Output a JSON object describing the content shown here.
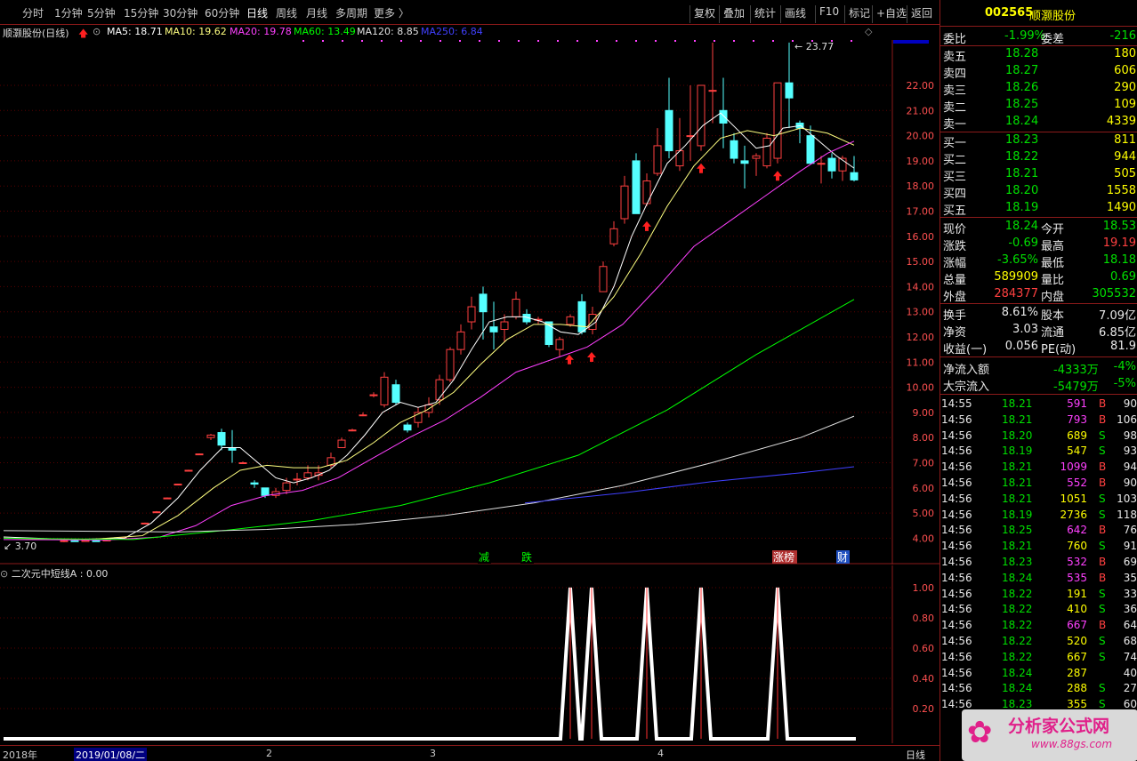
{
  "toolbar": {
    "periods": [
      "分时",
      "1分钟",
      "5分钟",
      "15分钟",
      "30分钟",
      "60分钟",
      "日线",
      "周线",
      "月线",
      "多周期",
      "更多 〉"
    ],
    "active_period": "日线",
    "tools": [
      "复权",
      "叠加",
      "统计",
      "画线",
      "F10",
      "标记",
      "+自选",
      "返回"
    ]
  },
  "stock": {
    "code": "002565",
    "name": "顺灏股份"
  },
  "main_chart": {
    "title": "顺灏股份(日线)",
    "ma_labels": [
      {
        "text": "MA5: 18.71",
        "color": "#ffffff"
      },
      {
        "text": "MA10: 19.62",
        "color": "#ffff80"
      },
      {
        "text": "MA20: 19.78",
        "color": "#ff40ff"
      },
      {
        "text": "MA60: 13.49",
        "color": "#00ff00"
      },
      {
        "text": "MA120: 8.85",
        "color": "#e0e0e0"
      },
      {
        "text": "MA250: 6.84",
        "color": "#4040ff"
      }
    ],
    "high_marker": "23.77",
    "low_marker": "3.70",
    "top_price": "23.66",
    "price_ticks": [
      "22.00",
      "21.00",
      "20.00",
      "19.00",
      "18.00",
      "17.00",
      "16.00",
      "15.00",
      "14.00",
      "13.00",
      "12.00",
      "11.00",
      "10.00",
      "9.00",
      "8.00",
      "7.00",
      "6.00",
      "5.00",
      "4.00"
    ],
    "event_marks": [
      {
        "text": "减",
        "color": "#00ff00",
        "bg": "#000"
      },
      {
        "text": "跌",
        "color": "#00ff00",
        "bg": "#000"
      },
      {
        "text": "涨榜",
        "color": "#ffffff",
        "bg": "#b03030"
      },
      {
        "text": "财",
        "color": "#ffffff",
        "bg": "#2050c0"
      }
    ]
  },
  "indicator": {
    "label": "二次元中短线A : 0.00",
    "ticks": [
      "1.00",
      "0.80",
      "0.60",
      "0.40",
      "0.20"
    ]
  },
  "dates": {
    "year": "2018年",
    "selected": "2019/01/08/二",
    "m2": "2",
    "m3": "3",
    "m4": "4",
    "mode": "日线"
  },
  "quote": {
    "weibi_label": "委比",
    "weibi": "-1.99%",
    "weicha_label": "委差",
    "weicha": "-216",
    "asks": [
      {
        "label": "卖五",
        "price": "18.28",
        "vol": "180"
      },
      {
        "label": "卖四",
        "price": "18.27",
        "vol": "606"
      },
      {
        "label": "卖三",
        "price": "18.26",
        "vol": "290"
      },
      {
        "label": "卖二",
        "price": "18.25",
        "vol": "109"
      },
      {
        "label": "卖一",
        "price": "18.24",
        "vol": "4339"
      }
    ],
    "bids": [
      {
        "label": "买一",
        "price": "18.23",
        "vol": "811"
      },
      {
        "label": "买二",
        "price": "18.22",
        "vol": "944"
      },
      {
        "label": "买三",
        "price": "18.21",
        "vol": "505"
      },
      {
        "label": "买四",
        "price": "18.20",
        "vol": "1558"
      },
      {
        "label": "买五",
        "price": "18.19",
        "vol": "1490"
      }
    ],
    "stats": [
      {
        "l1": "现价",
        "v1": "18.24",
        "c1": "#00e000",
        "l2": "今开",
        "v2": "18.53",
        "c2": "#00e000"
      },
      {
        "l1": "涨跌",
        "v1": "-0.69",
        "c1": "#00e000",
        "l2": "最高",
        "v2": "19.19",
        "c2": "#ff4040"
      },
      {
        "l1": "涨幅",
        "v1": "-3.65%",
        "c1": "#00e000",
        "l2": "最低",
        "v2": "18.18",
        "c2": "#00e000"
      },
      {
        "l1": "总量",
        "v1": "589909",
        "c1": "#ffff00",
        "l2": "量比",
        "v2": "0.69",
        "c2": "#00e000"
      },
      {
        "l1": "外盘",
        "v1": "284377",
        "c1": "#ff4040",
        "l2": "内盘",
        "v2": "305532",
        "c2": "#00e000"
      }
    ],
    "stats2": [
      {
        "l1": "换手",
        "v1": "8.61%",
        "c1": "#e8e8e8",
        "l2": "股本",
        "v2": "7.09亿",
        "c2": "#e8e8e8"
      },
      {
        "l1": "净资",
        "v1": "3.03",
        "c1": "#e8e8e8",
        "l2": "流通",
        "v2": "6.85亿",
        "c2": "#e8e8e8"
      },
      {
        "l1": "收益(一)",
        "v1": "0.056",
        "c1": "#e8e8e8",
        "l2": "PE(动)",
        "v2": "81.9",
        "c2": "#e8e8e8"
      }
    ],
    "flows": [
      {
        "label": "净流入额",
        "val": "-4333万",
        "pct": "-4%"
      },
      {
        "label": "大宗流入",
        "val": "-5479万",
        "pct": "-5%"
      }
    ]
  },
  "ticks": [
    {
      "t": "14:55",
      "p": "18.21",
      "v": "591",
      "d": "B",
      "n": "90"
    },
    {
      "t": "14:56",
      "p": "18.21",
      "v": "793",
      "d": "B",
      "n": "106"
    },
    {
      "t": "14:56",
      "p": "18.20",
      "v": "689",
      "d": "S",
      "n": "98"
    },
    {
      "t": "14:56",
      "p": "18.19",
      "v": "547",
      "d": "S",
      "n": "93"
    },
    {
      "t": "14:56",
      "p": "18.21",
      "v": "1099",
      "d": "B",
      "n": "94"
    },
    {
      "t": "14:56",
      "p": "18.21",
      "v": "552",
      "d": "B",
      "n": "90"
    },
    {
      "t": "14:56",
      "p": "18.21",
      "v": "1051",
      "d": "S",
      "n": "103"
    },
    {
      "t": "14:56",
      "p": "18.19",
      "v": "2736",
      "d": "S",
      "n": "118"
    },
    {
      "t": "14:56",
      "p": "18.25",
      "v": "642",
      "d": "B",
      "n": "76"
    },
    {
      "t": "14:56",
      "p": "18.21",
      "v": "760",
      "d": "S",
      "n": "91"
    },
    {
      "t": "14:56",
      "p": "18.23",
      "v": "532",
      "d": "B",
      "n": "69"
    },
    {
      "t": "14:56",
      "p": "18.24",
      "v": "535",
      "d": "B",
      "n": "35"
    },
    {
      "t": "14:56",
      "p": "18.22",
      "v": "191",
      "d": "S",
      "n": "33"
    },
    {
      "t": "14:56",
      "p": "18.22",
      "v": "410",
      "d": "S",
      "n": "36"
    },
    {
      "t": "14:56",
      "p": "18.22",
      "v": "667",
      "d": "B",
      "n": "64"
    },
    {
      "t": "14:56",
      "p": "18.22",
      "v": "520",
      "d": "S",
      "n": "68"
    },
    {
      "t": "14:56",
      "p": "18.22",
      "v": "667",
      "d": "S",
      "n": "74"
    },
    {
      "t": "14:56",
      "p": "18.24",
      "v": "287",
      "d": "",
      "n": "40"
    },
    {
      "t": "14:56",
      "p": "18.24",
      "v": "288",
      "d": "S",
      "n": "27"
    },
    {
      "t": "14:56",
      "p": "18.23",
      "v": "355",
      "d": "S",
      "n": "60"
    }
  ],
  "watermark": {
    "title": "分析家公式网",
    "url": "www.88gs.com"
  },
  "colors": {
    "up": "#ff4040",
    "down": "#00e000",
    "border": "#8b1a1a",
    "hollow_down": "#55ffff"
  }
}
